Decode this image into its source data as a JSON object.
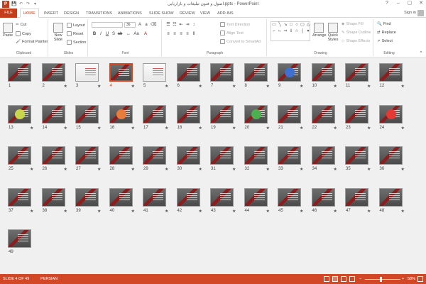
{
  "window": {
    "title": "اصول و فنون تبلیغات و بازاریابی.ppts - PowerPoint",
    "app_icon": "P",
    "signin": "Sign in",
    "controls": {
      "help": "?",
      "minimize": "–",
      "restore": "▢",
      "close": "✕"
    }
  },
  "qat": {
    "save": "💾",
    "undo": "↶",
    "redo": "↷",
    "customize": "▾"
  },
  "tabs": [
    {
      "label": "FILE"
    },
    {
      "label": "HOME"
    },
    {
      "label": "INSERT"
    },
    {
      "label": "DESIGN"
    },
    {
      "label": "TRANSITIONS"
    },
    {
      "label": "ANIMATIONS"
    },
    {
      "label": "SLIDE SHOW"
    },
    {
      "label": "REVIEW"
    },
    {
      "label": "VIEW"
    },
    {
      "label": "ADD-INS"
    }
  ],
  "ribbon": {
    "clipboard": {
      "label": "Clipboard",
      "paste": "Paste",
      "cut": "Cut",
      "copy": "Copy",
      "format_painter": "Format Painter"
    },
    "slides": {
      "label": "Slides",
      "new_slide": "New Slide",
      "layout": "Layout",
      "reset": "Reset",
      "section": "Section"
    },
    "font": {
      "label": "Font",
      "font_size": "36"
    },
    "paragraph": {
      "label": "Paragraph",
      "text_direction": "Text Direction",
      "align_text": "Align Text",
      "convert": "Convert to SmartArt"
    },
    "drawing": {
      "label": "Drawing",
      "arrange": "Arrange",
      "quick_styles": "Quick Styles",
      "shape_fill": "Shape Fill",
      "shape_outline": "Shape Outline",
      "shape_effects": "Shape Effects"
    },
    "editing": {
      "label": "Editing",
      "find": "Find",
      "replace": "Replace",
      "select": "Select"
    }
  },
  "slides": [
    {
      "num": "1",
      "star": ""
    },
    {
      "num": "2",
      "star": "★"
    },
    {
      "num": "3",
      "star": "★"
    },
    {
      "num": "4",
      "star": "★"
    },
    {
      "num": "5",
      "star": "★"
    },
    {
      "num": "6",
      "star": "★"
    },
    {
      "num": "7",
      "star": "★"
    },
    {
      "num": "8",
      "star": "★"
    },
    {
      "num": "9",
      "star": "★"
    },
    {
      "num": "10",
      "star": "★"
    },
    {
      "num": "11",
      "star": "★"
    },
    {
      "num": "12",
      "star": "★"
    },
    {
      "num": "13",
      "star": "★"
    },
    {
      "num": "14",
      "star": "★"
    },
    {
      "num": "15",
      "star": "★"
    },
    {
      "num": "16",
      "star": "★"
    },
    {
      "num": "17",
      "star": "★"
    },
    {
      "num": "18",
      "star": "★"
    },
    {
      "num": "19",
      "star": "★"
    },
    {
      "num": "20",
      "star": "★"
    },
    {
      "num": "21",
      "star": "★"
    },
    {
      "num": "22",
      "star": "★"
    },
    {
      "num": "23",
      "star": "★"
    },
    {
      "num": "24",
      "star": "★"
    },
    {
      "num": "25",
      "star": "★"
    },
    {
      "num": "26",
      "star": "★"
    },
    {
      "num": "27",
      "star": "★"
    },
    {
      "num": "28",
      "star": "★"
    },
    {
      "num": "29",
      "star": "★"
    },
    {
      "num": "30",
      "star": "★"
    },
    {
      "num": "31",
      "star": "★"
    },
    {
      "num": "32",
      "star": "★"
    },
    {
      "num": "33",
      "star": "★"
    },
    {
      "num": "34",
      "star": "★"
    },
    {
      "num": "35",
      "star": "★"
    },
    {
      "num": "36",
      "star": "★"
    },
    {
      "num": "37",
      "star": "★"
    },
    {
      "num": "38",
      "star": "★"
    },
    {
      "num": "39",
      "star": "★"
    },
    {
      "num": "40",
      "star": "★"
    },
    {
      "num": "41",
      "star": "★"
    },
    {
      "num": "42",
      "star": "★"
    },
    {
      "num": "43",
      "star": "★"
    },
    {
      "num": "44",
      "star": "★"
    },
    {
      "num": "45",
      "star": "★"
    },
    {
      "num": "46",
      "star": "★"
    },
    {
      "num": "47",
      "star": "★"
    },
    {
      "num": "48",
      "star": "★"
    },
    {
      "num": "49",
      "star": ""
    }
  ],
  "status": {
    "slide_info": "SLIDE 4 OF 49",
    "language": "PERSIAN",
    "zoom": "58%"
  },
  "colors": {
    "accent": "#d24726",
    "file_tab": "#c43e1c"
  }
}
